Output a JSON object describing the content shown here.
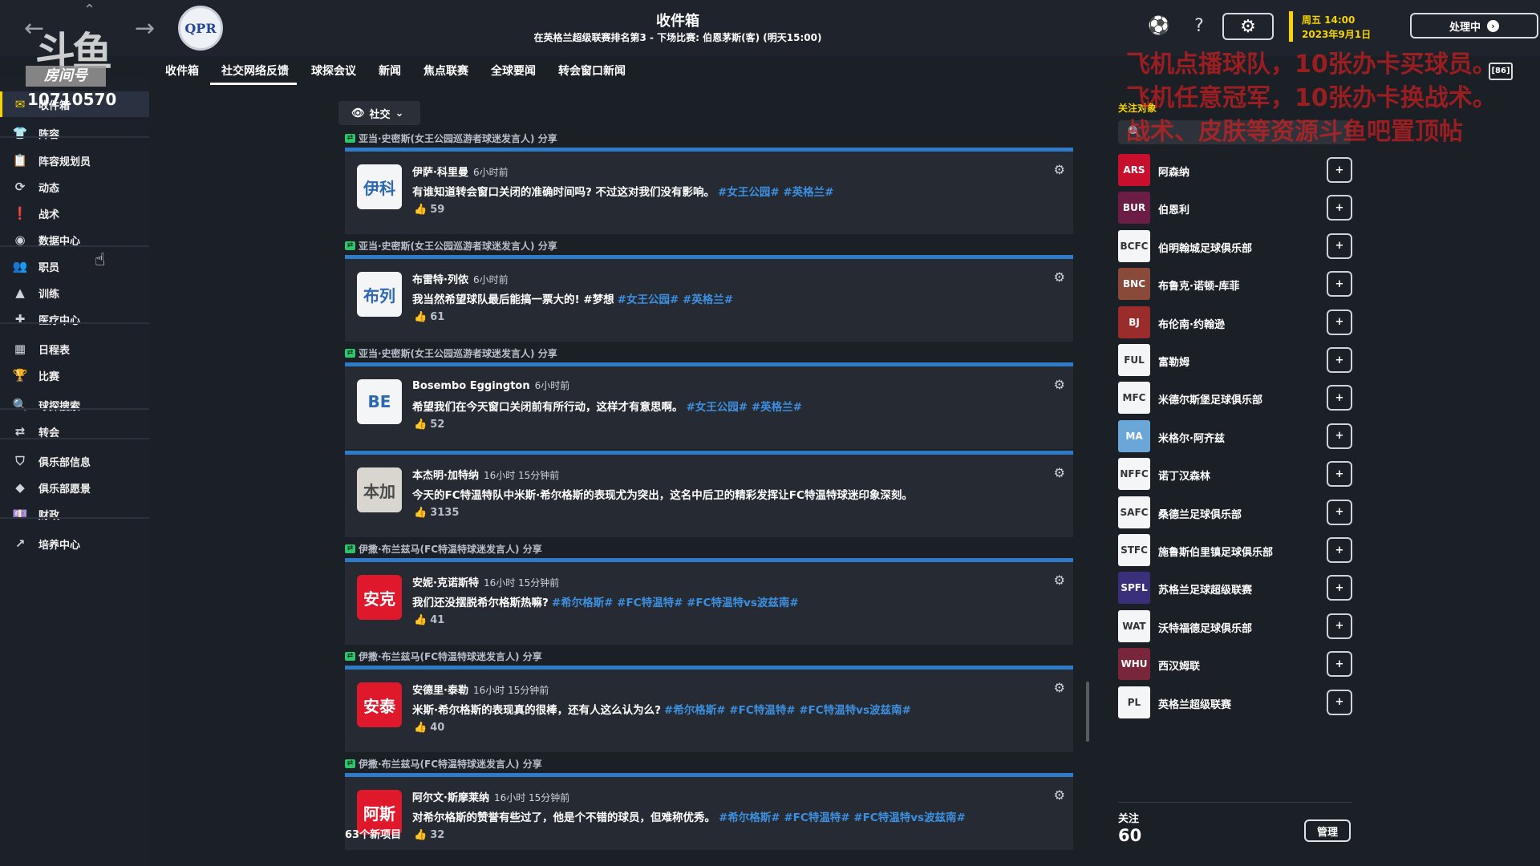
{
  "header": {
    "title": "收件箱",
    "subtitle": "在英格兰超级联赛排名第3 - 下场比赛: 伯恩茅斯(客) (明天15:00)",
    "club_crest": "QPR",
    "date_day": "周五 14:00",
    "date_full": "2023年9月1日",
    "continue_label": "处理中"
  },
  "watermark": {
    "logo": "斗鱼",
    "room_label": "房间号",
    "room_id": "10710570"
  },
  "tabs": [
    "收件箱",
    "社交网络反馈",
    "球探会议",
    "新闻",
    "焦点联赛",
    "全球要闻",
    "转会窗口新闻"
  ],
  "sidebar": {
    "items": [
      {
        "label": "收件箱",
        "icon": "inbox-icon",
        "glyph": "✉"
      },
      {
        "label": "阵容",
        "icon": "squad-icon",
        "glyph": "👕"
      },
      {
        "label": "阵容规划员",
        "icon": "clipboard-icon",
        "glyph": "📋"
      },
      {
        "label": "动态",
        "icon": "dynamics-icon",
        "glyph": "⟳"
      },
      {
        "label": "战术",
        "icon": "tactics-icon",
        "glyph": "❗"
      },
      {
        "label": "数据中心",
        "icon": "data-hub-icon",
        "glyph": "◉"
      },
      {
        "label": "职员",
        "icon": "staff-icon",
        "glyph": "👥"
      },
      {
        "label": "训练",
        "icon": "training-icon",
        "glyph": "▲"
      },
      {
        "label": "医疗中心",
        "icon": "medical-icon",
        "glyph": "✚"
      },
      {
        "label": "日程表",
        "icon": "calendar-icon",
        "glyph": "▦"
      },
      {
        "label": "比赛",
        "icon": "trophy-icon",
        "glyph": "🏆"
      },
      {
        "label": "球探搜索",
        "icon": "search-icon",
        "glyph": "🔍"
      },
      {
        "label": "转会",
        "icon": "transfer-icon",
        "glyph": "⇄"
      },
      {
        "label": "俱乐部信息",
        "icon": "shield-icon",
        "glyph": "⛉"
      },
      {
        "label": "俱乐部愿景",
        "icon": "vision-icon",
        "glyph": "◆"
      },
      {
        "label": "财政",
        "icon": "finance-icon",
        "glyph": "💷"
      },
      {
        "label": "培养中心",
        "icon": "development-icon",
        "glyph": "↗"
      }
    ]
  },
  "filter": {
    "label": "社交"
  },
  "feed": [
    {
      "share": "亚当·史密斯(女王公园巡游者球迷发言人) 分享",
      "avatar": "伊科",
      "avatar_style": "white",
      "author": "伊萨·科里曼",
      "time": "6小时前",
      "text": "有谁知道转会窗口关闭的准确时间吗? 不过这对我们没有影响。",
      "tags": "#女王公园# #英格兰#",
      "likes": "59"
    },
    {
      "share": "亚当·史密斯(女王公园巡游者球迷发言人) 分享",
      "avatar": "布列",
      "avatar_style": "white",
      "author": "布雷特·列侬",
      "time": "6小时前",
      "text": "我当然希望球队最后能搞一票大的! #梦想",
      "tags": "#女王公园# #英格兰#",
      "likes": "61"
    },
    {
      "share": "亚当·史密斯(女王公园巡游者球迷发言人) 分享",
      "avatar": "BE",
      "avatar_style": "white",
      "author": "Bosembo Eggington",
      "time": "6小时前",
      "text": "希望我们在今天窗口关闭前有所行动，这样才有意思啊。",
      "tags": "#女王公园# #英格兰#",
      "likes": "52"
    },
    {
      "share": "",
      "avatar": "本加",
      "avatar_style": "grey",
      "author": "本杰明·加特纳",
      "time": "16小时 15分钟前",
      "text": "今天的FC特温特队中米斯·希尔格斯的表现尤为突出，这名中后卫的精彩发挥让FC特温特球迷印象深刻。",
      "tags": "",
      "likes": "3135"
    },
    {
      "share": "伊撒·布兰兹马(FC特温特球迷发言人) 分享",
      "avatar": "安克",
      "avatar_style": "red",
      "author": "安妮·克诺斯特",
      "time": "16小时 15分钟前",
      "text": "我们还没摆脱希尔格斯热嘛?",
      "tags": "#希尔格斯# #FC特温特# #FC特温特vs波兹南#",
      "likes": "41"
    },
    {
      "share": "伊撒·布兰兹马(FC特温特球迷发言人) 分享",
      "avatar": "安泰",
      "avatar_style": "red",
      "author": "安德里·泰勒",
      "time": "16小时 15分钟前",
      "text": "米斯·希尔格斯的表现真的很棒，还有人这么认为么?",
      "tags": "#希尔格斯# #FC特温特# #FC特温特vs波兹南#",
      "likes": "40"
    },
    {
      "share": "伊撒·布兰兹马(FC特温特球迷发言人) 分享",
      "avatar": "阿斯",
      "avatar_style": "red",
      "author": "阿尔文·斯摩莱纳",
      "time": "16小时 15分钟前",
      "text": "对希尔格斯的赞誉有些过了，他是个不错的球员，但难称优秀。",
      "tags": "#希尔格斯# #FC特温特# #FC特温特vs波兹南#",
      "likes": "32"
    }
  ],
  "new_items": "63个新项目",
  "follow": {
    "title": "关注对象",
    "items": [
      {
        "name": "阿森纳",
        "logo": "ARS",
        "color": "#c8102e"
      },
      {
        "name": "伯恩利",
        "logo": "BUR",
        "color": "#6c1d45"
      },
      {
        "name": "伯明翰城足球俱乐部",
        "logo": "BCFC",
        "color": "#f4f5f7"
      },
      {
        "name": "布鲁克·诺顿-库菲",
        "logo": "BNC",
        "color": "#8a4a3a"
      },
      {
        "name": "布伦南·约翰逊",
        "logo": "BJ",
        "color": "#9b2c2c"
      },
      {
        "name": "富勒姆",
        "logo": "FUL",
        "color": "#f4f5f7"
      },
      {
        "name": "米德尔斯堡足球俱乐部",
        "logo": "MFC",
        "color": "#f4f5f7"
      },
      {
        "name": "米格尔·阿齐兹",
        "logo": "MA",
        "color": "#6aa6d8"
      },
      {
        "name": "诺丁汉森林",
        "logo": "NFFC",
        "color": "#f4f5f7"
      },
      {
        "name": "桑德兰足球俱乐部",
        "logo": "SAFC",
        "color": "#f4f5f7"
      },
      {
        "name": "施鲁斯伯里镇足球俱乐部",
        "logo": "STFC",
        "color": "#f4f5f7"
      },
      {
        "name": "苏格兰足球超级联赛",
        "logo": "SPFL",
        "color": "#3a2f7a"
      },
      {
        "name": "沃特福德足球俱乐部",
        "logo": "WAT",
        "color": "#f4f5f7"
      },
      {
        "name": "西汉姆联",
        "logo": "WHU",
        "color": "#7a263a"
      },
      {
        "name": "英格兰超级联赛",
        "logo": "PL",
        "color": "#f4f5f7"
      }
    ],
    "count_label": "关注",
    "count": "60",
    "manage_label": "管理",
    "add_label": "+"
  },
  "overlay": {
    "lines": [
      "飞机点播球队，10张办卡买球员。",
      "飞机任意冠军，10张办卡换战术。",
      "战术、皮肤等资源斗鱼吧置顶帖"
    ],
    "badge": "[86]"
  }
}
